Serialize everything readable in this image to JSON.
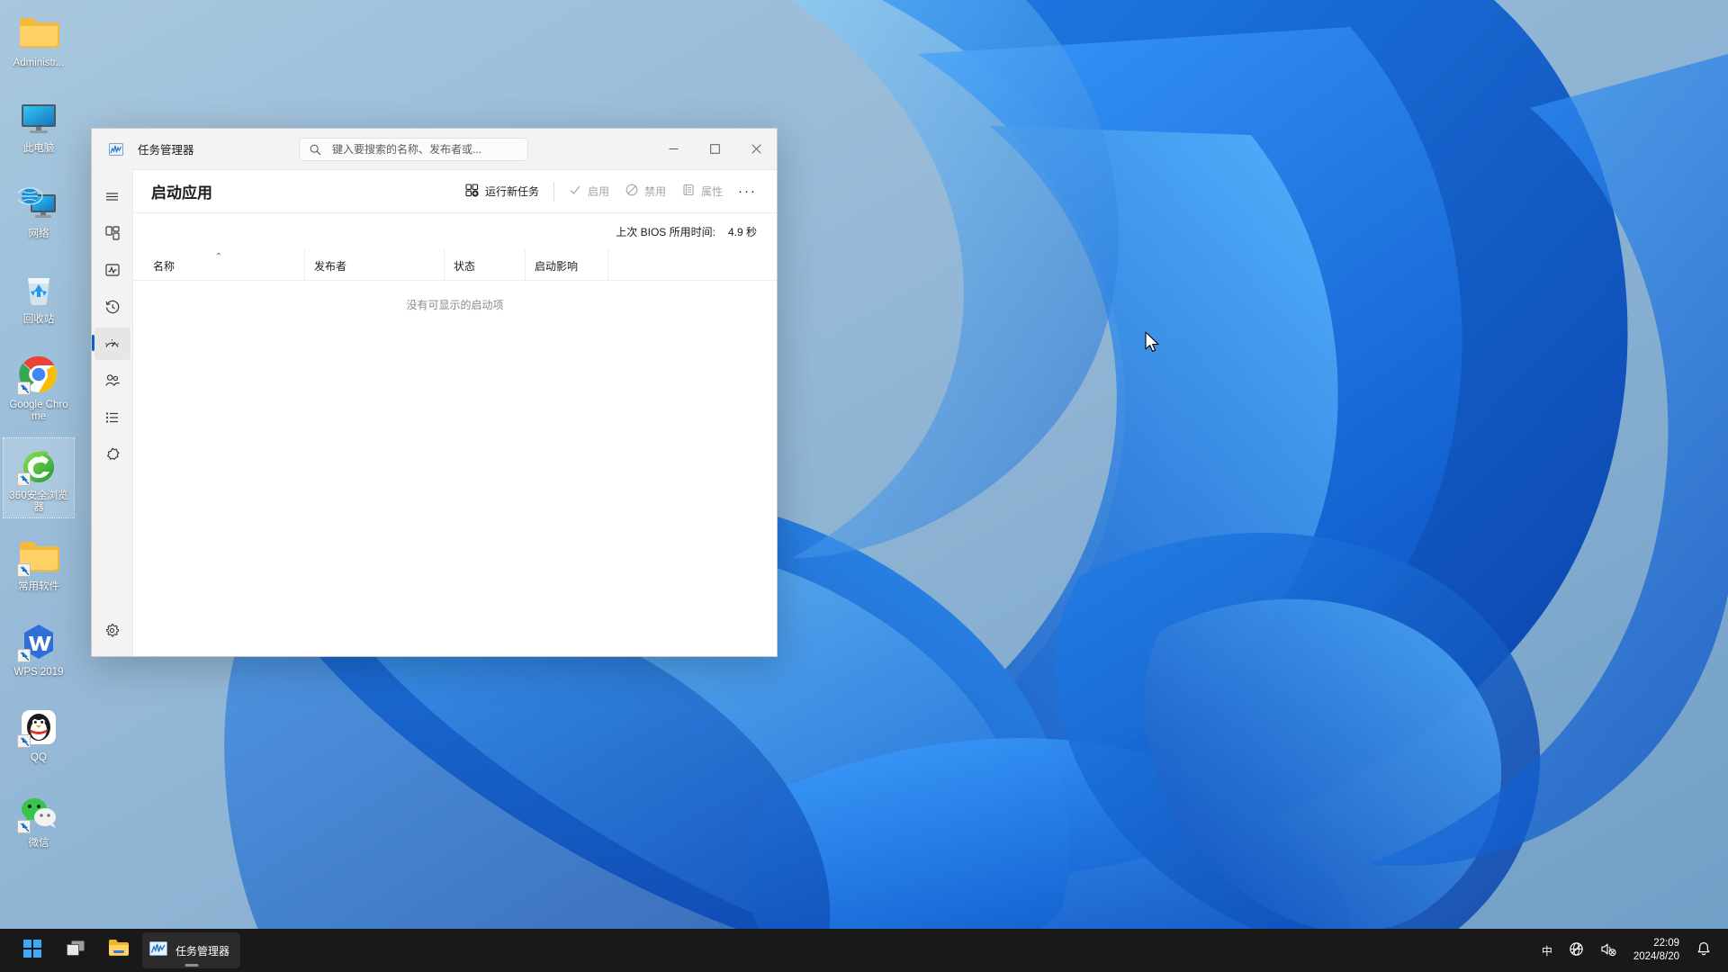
{
  "desktop": {
    "icons": [
      {
        "label": "Administr...",
        "icon": "folder-icon",
        "shortcut": false,
        "selected": false
      },
      {
        "label": "此电脑",
        "icon": "this-pc-icon",
        "shortcut": false,
        "selected": false
      },
      {
        "label": "网络",
        "icon": "network-icon",
        "shortcut": false,
        "selected": false
      },
      {
        "label": "回收站",
        "icon": "recycle-bin-icon",
        "shortcut": false,
        "selected": false
      },
      {
        "label": "Google Chrome",
        "icon": "chrome-icon",
        "shortcut": true,
        "selected": false
      },
      {
        "label": "360安全浏览器",
        "icon": "ie360-browser-icon",
        "shortcut": true,
        "selected": true
      },
      {
        "label": "常用软件",
        "icon": "folder-icon",
        "shortcut": true,
        "selected": false
      },
      {
        "label": "WPS 2019",
        "icon": "wps-icon",
        "shortcut": true,
        "selected": false
      },
      {
        "label": "QQ",
        "icon": "qq-icon",
        "shortcut": true,
        "selected": false
      },
      {
        "label": "微信",
        "icon": "wechat-icon",
        "shortcut": true,
        "selected": false
      }
    ]
  },
  "window": {
    "title": "任务管理器",
    "app_icon": "task-manager-icon",
    "search": {
      "placeholder": "键入要搜索的名称、发布者或...",
      "value": "",
      "icon": "search-icon"
    },
    "controls": {
      "minimize": "minimize-icon",
      "maximize": "maximize-icon",
      "close": "close-icon"
    }
  },
  "rail": {
    "items": [
      {
        "name": "hamburger-menu",
        "icon": "hamburger-icon",
        "selected": false
      },
      {
        "name": "processes",
        "icon": "processes-grid-icon",
        "selected": false
      },
      {
        "name": "performance",
        "icon": "performance-pulse-icon",
        "selected": false
      },
      {
        "name": "app-history",
        "icon": "history-clock-icon",
        "selected": false
      },
      {
        "name": "startup-apps",
        "icon": "startup-gauge-icon",
        "selected": true
      },
      {
        "name": "users",
        "icon": "users-people-icon",
        "selected": false
      },
      {
        "name": "details",
        "icon": "details-list-icon",
        "selected": false
      },
      {
        "name": "services",
        "icon": "services-gear-icon",
        "selected": false
      }
    ],
    "settings": {
      "name": "settings",
      "icon": "gear-icon"
    }
  },
  "toolbar": {
    "page_title": "启动应用",
    "run_new_task": {
      "label": "运行新任务",
      "icon": "run-new-task-icon",
      "disabled": false
    },
    "enable": {
      "label": "启用",
      "icon": "check-icon",
      "disabled": true
    },
    "disable": {
      "label": "禁用",
      "icon": "block-icon",
      "disabled": true
    },
    "properties": {
      "label": "属性",
      "icon": "properties-icon",
      "disabled": true
    },
    "more": {
      "label": "···",
      "icon": "more-ellipsis-icon"
    }
  },
  "bios": {
    "label": "上次 BIOS 所用时间:",
    "value": "4.9 秒"
  },
  "table": {
    "columns": [
      {
        "label": "名称",
        "sort": "asc",
        "sort_caret": "⌃"
      },
      {
        "label": "发布者",
        "sort": ""
      },
      {
        "label": "状态",
        "sort": ""
      },
      {
        "label": "启动影响",
        "sort": ""
      },
      {
        "label": "",
        "sort": ""
      }
    ],
    "rows": [],
    "empty_message": "没有可显示的启动项"
  },
  "taskbar": {
    "start": {
      "name": "start-button",
      "icon": "windows-logo-icon"
    },
    "task_view": {
      "name": "task-view-button",
      "icon": "task-view-icon"
    },
    "file_explorer": {
      "name": "file-explorer-button",
      "icon": "folder-icon"
    },
    "active_app": {
      "label": "任务管理器",
      "icon": "task-manager-icon"
    },
    "tray": {
      "ime": "中",
      "network": "network-disconnected-icon",
      "volume": "volume-muted-icon",
      "time": "22:09",
      "date": "2024/8/20",
      "notifications": "bell-icon"
    }
  },
  "colors": {
    "accent": "#0a62c9",
    "window_bg": "#f3f3f3",
    "content_bg": "#ffffff",
    "taskbar_bg": "#191919",
    "close_hover": "#e81123"
  }
}
